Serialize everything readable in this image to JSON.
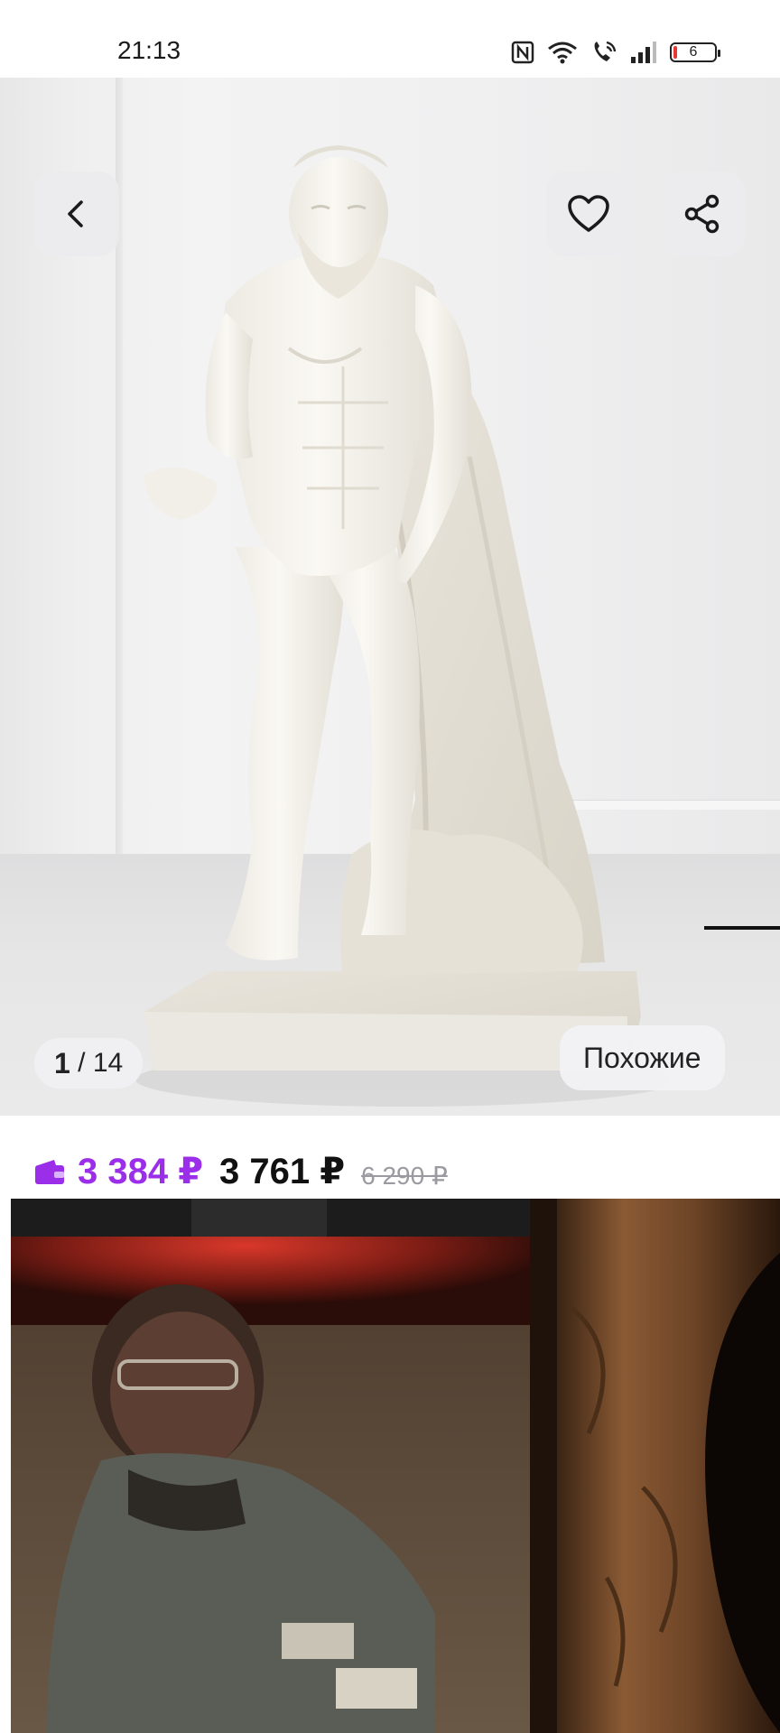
{
  "status_bar": {
    "time": "21:13",
    "battery_level": "6"
  },
  "gallery": {
    "counter_current": "1",
    "counter_total": "14",
    "similar_label": "Похожие"
  },
  "price": {
    "wallet_price": "3 384 ₽",
    "current_price": "3 761 ₽",
    "old_price": "6 290 ₽"
  },
  "colors": {
    "accent": "#9b2ee8",
    "text": "#111111",
    "muted": "#9a9aa0"
  },
  "icons": {
    "back": "chevron-left-icon",
    "favorite": "heart-icon",
    "share": "share-icon",
    "wallet": "wallet-icon"
  }
}
